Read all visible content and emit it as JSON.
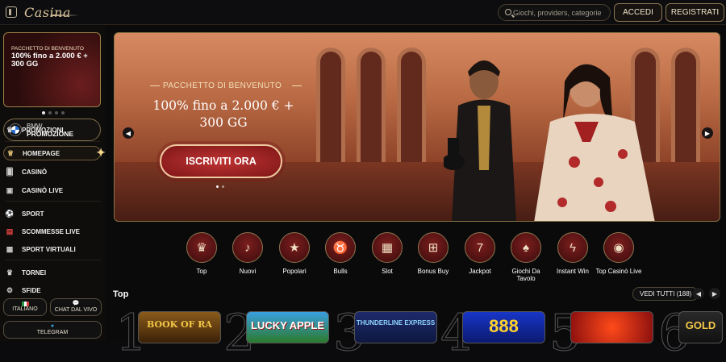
{
  "header": {
    "logo_text": "Casina",
    "search_placeholder": "Giochi, providers, categorie",
    "login_label": "ACCEDI",
    "register_label": "REGISTRATI"
  },
  "sidebar": {
    "promo_card": {
      "eyebrow": "PACCHETTO DI BENVENUTO",
      "headline": "100% fino a 2.000 € + 300 GG"
    },
    "bmw": {
      "line1": "BMW",
      "line2": "PROMOZIONE"
    },
    "items": [
      {
        "label": "PROMOZIONI",
        "icon": "gift-icon"
      },
      {
        "label": "HOMEPAGE",
        "icon": "crown-icon"
      },
      {
        "label": "CASINÒ",
        "icon": "cards-icon"
      },
      {
        "label": "CASINÒ LIVE",
        "icon": "live-icon"
      },
      {
        "label": "SPORT",
        "icon": "ball-icon"
      },
      {
        "label": "SCOMMESSE LIVE",
        "icon": "live-bet-icon"
      },
      {
        "label": "SPORT VIRTUALI",
        "icon": "virtual-icon"
      },
      {
        "label": "TORNEI",
        "icon": "trophy-icon"
      },
      {
        "label": "SFIDE",
        "icon": "challenge-icon"
      }
    ],
    "language_label": "ITALIANO",
    "chat_label": "CHAT DAL VIVO",
    "telegram_label": "TELEGRAM"
  },
  "hero": {
    "subtitle": "PACCHETTO DI BENVENUTO",
    "title": "100% fino a 2.000 € + 300 GG",
    "cta": "ISCRIVITI ORA"
  },
  "categories": [
    {
      "label": "Top",
      "icon": "crown-icon"
    },
    {
      "label": "Nuovi",
      "icon": "bell-icon"
    },
    {
      "label": "Popolari",
      "icon": "star-icon"
    },
    {
      "label": "Bulls",
      "icon": "bull-icon"
    },
    {
      "label": "Slot",
      "icon": "slot-icon"
    },
    {
      "label": "Bonus Buy",
      "icon": "gift-box-icon"
    },
    {
      "label": "Jackpot",
      "icon": "seven-icon"
    },
    {
      "label": "Giochi Da Tavolo",
      "icon": "cards-icon"
    },
    {
      "label": "Instant Win",
      "icon": "lightning-icon"
    },
    {
      "label": "Top Casinò Live",
      "icon": "chip-icon"
    }
  ],
  "top_section": {
    "title": "Top",
    "see_all": "VEDI TUTTI (188)",
    "games": [
      {
        "rank": "1",
        "title": "BOOK OF RA"
      },
      {
        "rank": "2",
        "title": "LUCKY APPLE"
      },
      {
        "rank": "3",
        "title": "THUNDERLINE EXPRESS"
      },
      {
        "rank": "4",
        "title": "888"
      },
      {
        "rank": "5",
        "title": ""
      },
      {
        "rank": "6",
        "title": "GOLD"
      }
    ]
  },
  "colors": {
    "accent_gold": "#9b7f46",
    "cta_red": "#b02a2a",
    "bg": "#0b0b0d"
  }
}
